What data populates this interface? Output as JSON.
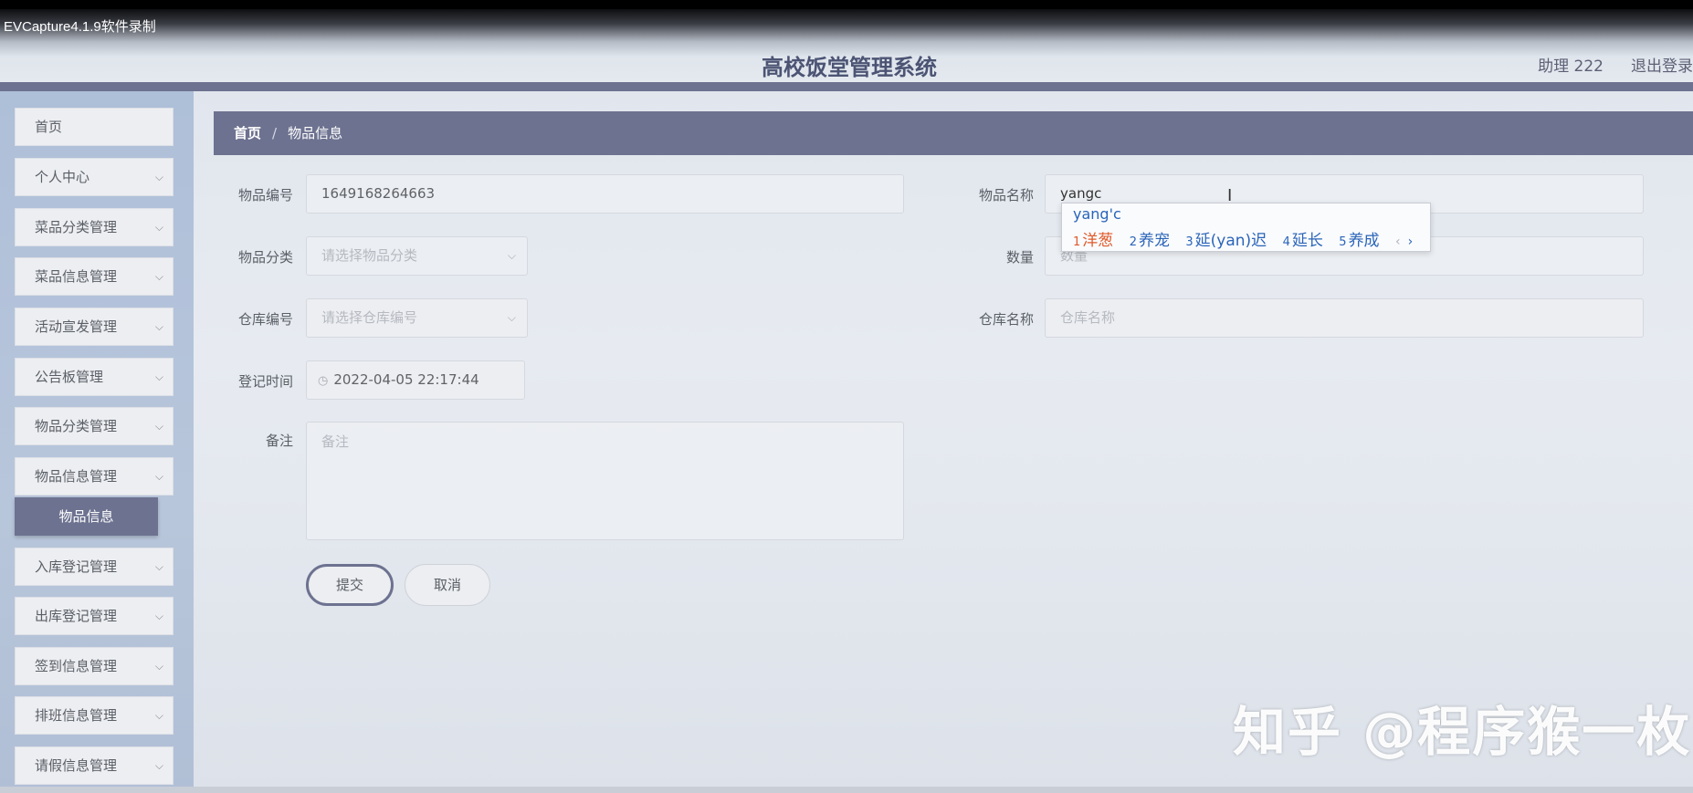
{
  "recording": {
    "label": "EVCapture4.1.9软件录制"
  },
  "header": {
    "title": "高校饭堂管理系统",
    "user": "助理 222",
    "logout": "退出登录"
  },
  "sidebar": {
    "items": [
      {
        "label": "首页",
        "chevron": false
      },
      {
        "label": "个人中心",
        "chevron": true
      },
      {
        "label": "菜品分类管理",
        "chevron": true
      },
      {
        "label": "菜品信息管理",
        "chevron": true
      },
      {
        "label": "活动宣发管理",
        "chevron": true
      },
      {
        "label": "公告板管理",
        "chevron": true
      },
      {
        "label": "物品分类管理",
        "chevron": true
      },
      {
        "label": "物品信息管理",
        "chevron": true
      },
      {
        "label": "入库登记管理",
        "chevron": true
      },
      {
        "label": "出库登记管理",
        "chevron": true
      },
      {
        "label": "签到信息管理",
        "chevron": true
      },
      {
        "label": "排班信息管理",
        "chevron": true
      },
      {
        "label": "请假信息管理",
        "chevron": true
      }
    ],
    "active_sub": "物品信息",
    "chevron_icon": "⌵"
  },
  "breadcrumb": {
    "home": "首页",
    "sep": "/",
    "current": "物品信息"
  },
  "form": {
    "item_no": {
      "label": "物品编号",
      "value": "1649168264663"
    },
    "item_name": {
      "label": "物品名称",
      "value": "yangc"
    },
    "category": {
      "label": "物品分类",
      "placeholder": "请选择物品分类"
    },
    "quantity": {
      "label": "数量",
      "placeholder": "数量"
    },
    "warehouse_no": {
      "label": "仓库编号",
      "placeholder": "请选择仓库编号"
    },
    "warehouse_name": {
      "label": "仓库名称",
      "placeholder": "仓库名称"
    },
    "reg_time": {
      "label": "登记时间",
      "value": "2022-04-05 22:17:44"
    },
    "remark": {
      "label": "备注",
      "placeholder": "备注"
    },
    "submit": "提交",
    "cancel": "取消"
  },
  "ime": {
    "composition": "yang'c",
    "candidates": [
      {
        "num": "1",
        "text": "洋葱"
      },
      {
        "num": "2",
        "text": "养宠"
      },
      {
        "num": "3",
        "text": "延(yan)迟"
      },
      {
        "num": "4",
        "text": "延长"
      },
      {
        "num": "5",
        "text": "养成"
      }
    ],
    "prev": "‹",
    "next": "›"
  },
  "watermark": "知乎 @程序猴一枚",
  "colors": {
    "accent": "#6d7290",
    "ime_selected": "#e05a2a",
    "ime_text": "#2a64b8"
  }
}
